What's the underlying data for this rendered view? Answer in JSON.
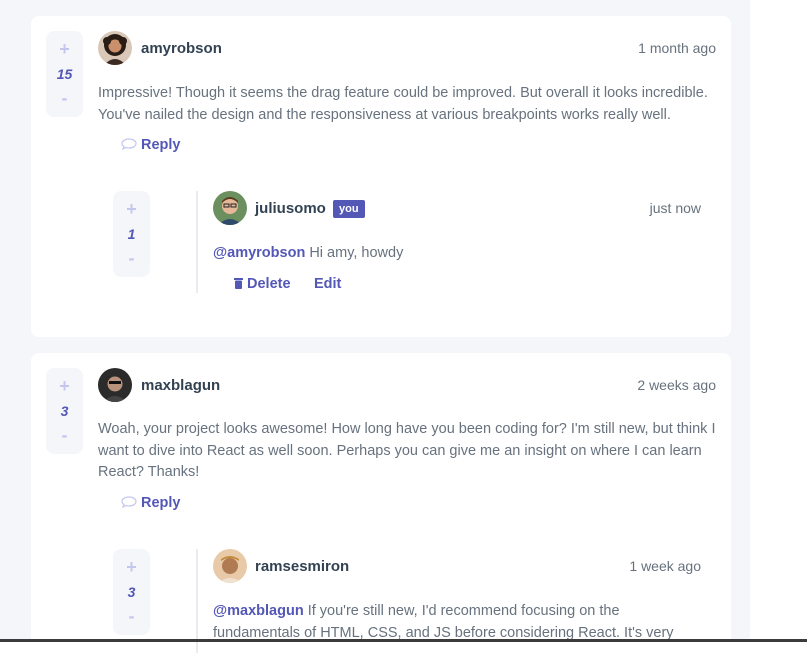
{
  "comments": [
    {
      "username": "amyrobson",
      "timestamp": "1 month ago",
      "score": "15",
      "text": "Impressive! Though it seems the drag feature could be improved. But overall it looks incredible. You've nailed the design and the responsiveness at various breakpoints works really well.",
      "reply_label": "Reply",
      "avatar_icon": "avatar-amyrobson-icon",
      "replies": [
        {
          "username": "juliusomo",
          "you_badge": "you",
          "timestamp": "just now",
          "score": "1",
          "mention": "@amyrobson",
          "text": " Hi amy, howdy",
          "delete_label": "Delete",
          "edit_label": "Edit",
          "avatar_icon": "avatar-juliusomo-icon"
        }
      ]
    },
    {
      "username": "maxblagun",
      "timestamp": "2 weeks ago",
      "score": "3",
      "text": "Woah, your project looks awesome! How long have you been coding for? I'm still new, but think I want to dive into React as well soon. Perhaps you can give me an insight on where I can learn React? Thanks!",
      "reply_label": "Reply",
      "avatar_icon": "avatar-maxblagun-icon",
      "replies": [
        {
          "username": "ramsesmiron",
          "timestamp": "1 week ago",
          "score": "3",
          "mention": "@maxblagun",
          "text": " If you're still new, I'd recommend focusing on the fundamentals of HTML, CSS, and JS before considering React. It's very",
          "avatar_icon": "avatar-ramsesmiron-icon"
        }
      ]
    }
  ],
  "vote_controls": {
    "plus": "+",
    "minus": "-"
  },
  "colors": {
    "primary": "#5357b6",
    "username": "#334253",
    "body": "#67727e",
    "vote_bg": "#f5f6fa",
    "vote_symbol": "#c5c6ef"
  }
}
